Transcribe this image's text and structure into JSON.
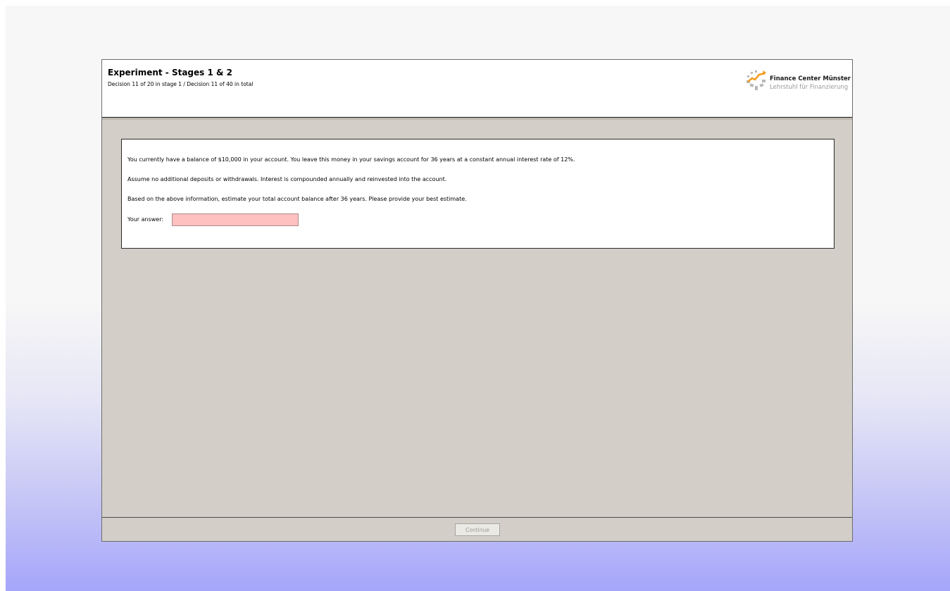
{
  "header": {
    "title": "Experiment - Stages 1 & 2",
    "subtitle": "Decision 11 of 20 in stage 1 / Decision 11 of 40 in total"
  },
  "logo": {
    "name": "Finance Center Münster",
    "subtitle": "Lehrstuhl für Finanzierung",
    "icon": "finance-center-logo-icon",
    "accent_color": "#f39a1e",
    "mark_color": "#b8b8b8"
  },
  "question": {
    "line1": "You currently have a balance of $10,000 in your account. You leave this money in your savings account for 36 years at a constant annual interest rate of 12%.",
    "line2": "Assume no additional deposits or withdrawals. Interest is compounded annually and reinvested into the account.",
    "line3": "Based on the above information, estimate your total account balance after 36 years. Please provide your best estimate.",
    "answer_label": "Your answer:",
    "answer_value": "",
    "answer_field_color": "#ffc0c0"
  },
  "footer": {
    "continue_label": "Continue"
  }
}
